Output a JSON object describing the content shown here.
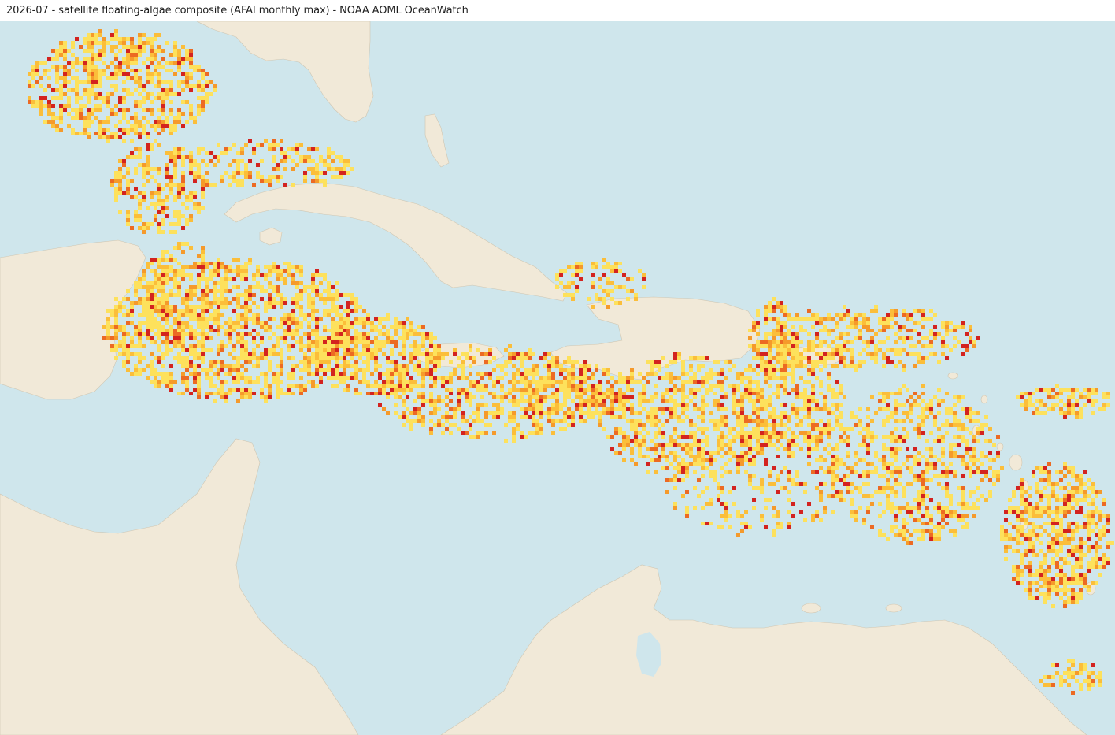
{
  "header": {
    "title": "2026-07 - satellite floating-algae composite (AFAI monthly max) - NOAA AOML OceanWatch"
  },
  "map": {
    "layer": "AFAI monthly max",
    "colors": {
      "ocean": "#cfe6ec",
      "land": "#f1e9d8",
      "coast": "#cfc6b2",
      "algae_low": "#fde15c",
      "algae_mid_low": "#fbbe3a",
      "algae_mid": "#f59a2b",
      "algae_high": "#ec6a23",
      "algae_max": "#d3231f"
    }
  }
}
